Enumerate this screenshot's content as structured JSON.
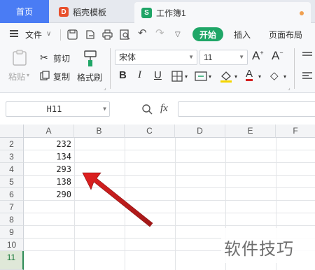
{
  "tabs": {
    "home": "首页",
    "docer": "稻壳模板",
    "workbook": "工作簿1"
  },
  "menu": {
    "file": "文件",
    "start": "开始",
    "insert": "插入",
    "page_layout": "页面布局"
  },
  "ribbon": {
    "paste": "粘贴",
    "cut": "剪切",
    "copy": "复制",
    "format_painter": "格式刷",
    "font_name": "宋体",
    "font_size": "11",
    "bold": "B",
    "italic": "I",
    "underline": "U",
    "font_color_letter": "A"
  },
  "formula_bar": {
    "name_box": "H11",
    "fx": "fx",
    "formula": ""
  },
  "grid": {
    "columns": [
      "A",
      "B",
      "C",
      "D",
      "E",
      "F"
    ],
    "rows": [
      "2",
      "3",
      "4",
      "5",
      "6",
      "7",
      "8",
      "9",
      "10",
      "11"
    ],
    "active_row": "11",
    "column_a_values": [
      "232",
      "134",
      "293",
      "138",
      "290"
    ]
  },
  "watermark": "软件技巧",
  "colors": {
    "accent_blue": "#4a7cf4",
    "start_green": "#1fa667",
    "arrow_red": "#d42020",
    "docer_red": "#e8502c"
  }
}
